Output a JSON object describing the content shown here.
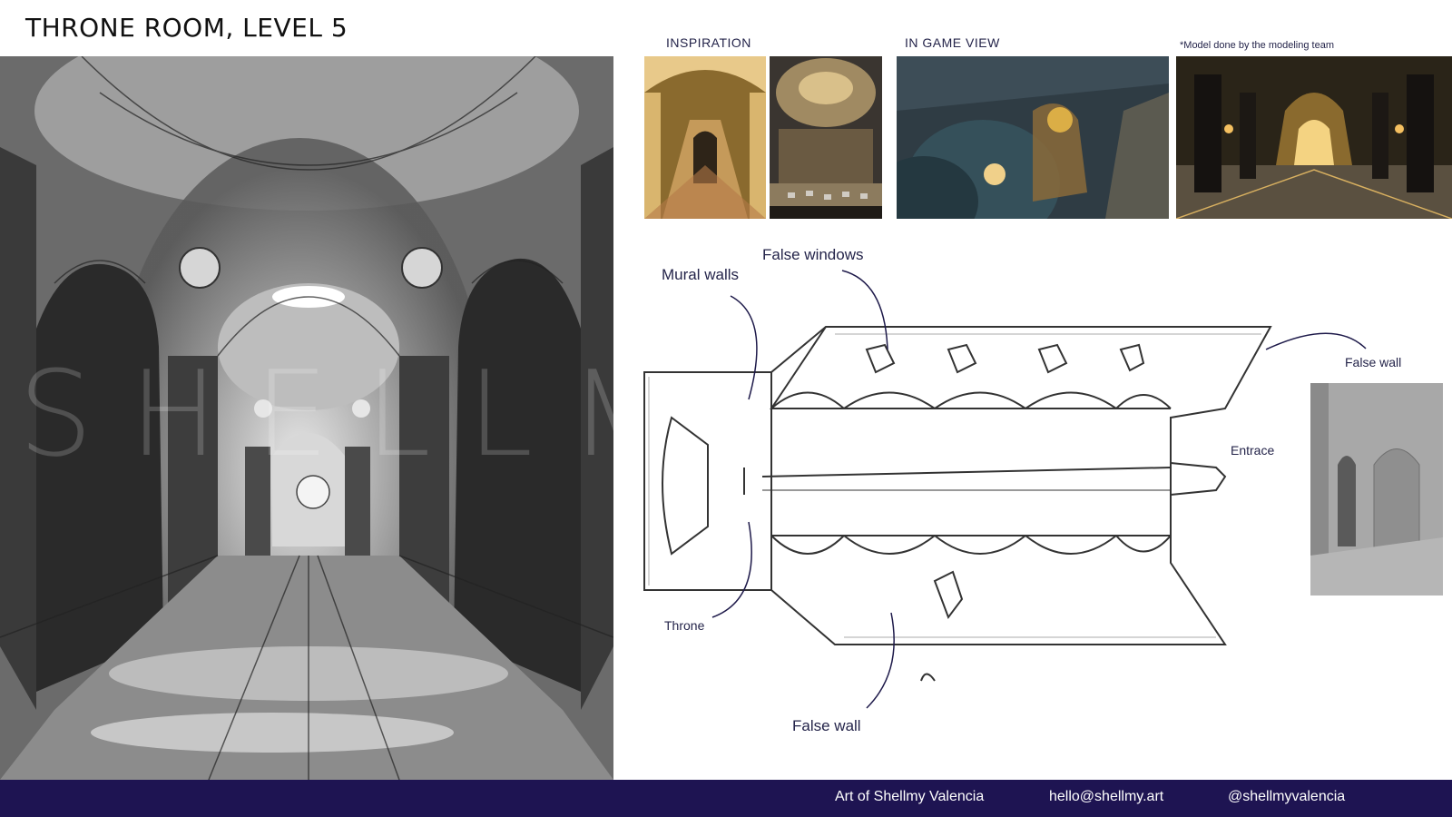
{
  "header": {
    "title": "THRONE ROOM, LEVEL 5"
  },
  "sections": {
    "inspiration": "INSPIRATION",
    "in_game_view": "IN GAME VIEW",
    "model_note": "*Model done by the modeling team"
  },
  "annotations": {
    "mural_walls": "Mural walls",
    "false_windows": "False windows",
    "false_wall_right": "False wall",
    "entrance": "Entrace",
    "throne": "Throne",
    "false_wall_bottom": "False wall"
  },
  "watermark": "SHELLMY VALENCIA",
  "footer": {
    "credit": "Art of Shellmy Valencia",
    "email": "hello@shellmy.art",
    "handle": "@shellmyvalencia"
  },
  "colors": {
    "footer_bg": "#1e1452",
    "text": "#24244a",
    "sketch_gray": "#6e6e6e"
  }
}
